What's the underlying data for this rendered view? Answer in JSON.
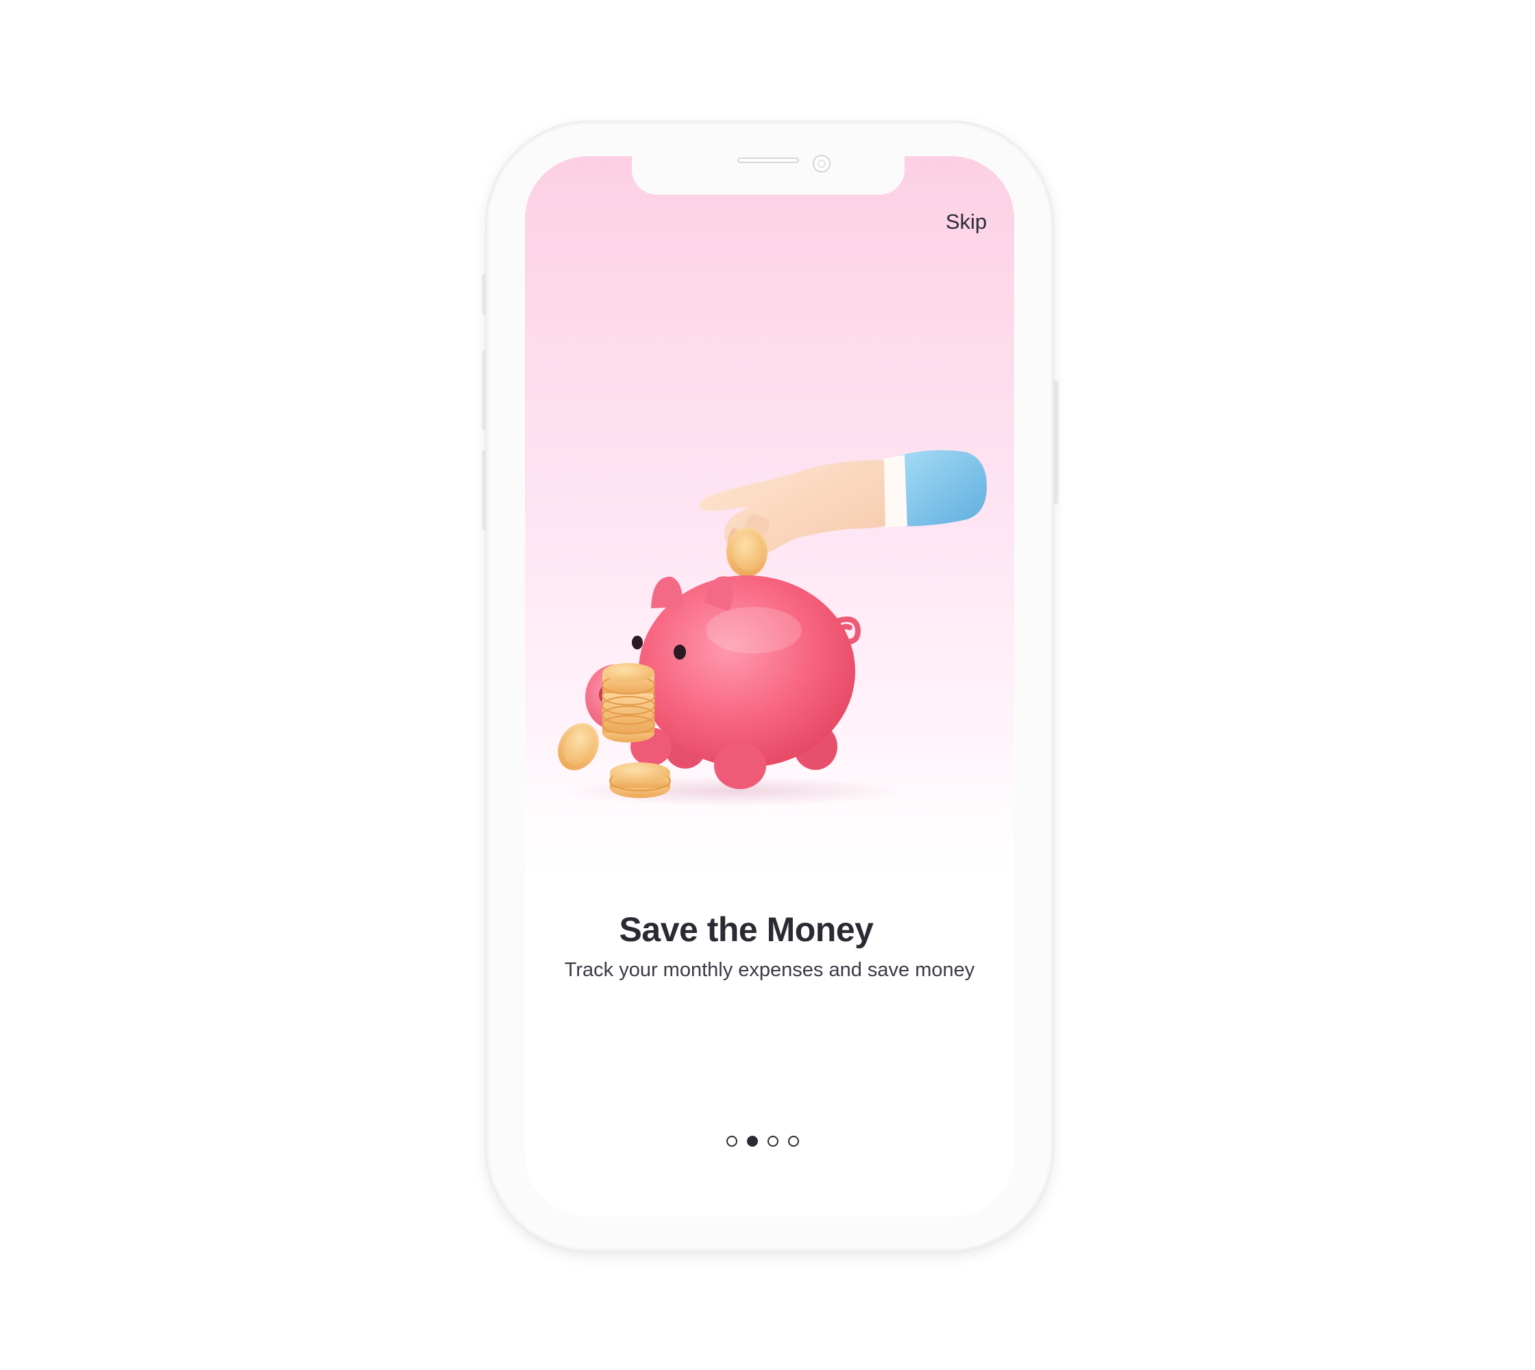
{
  "onboarding": {
    "skip_label": "Skip",
    "title": "Save the Money",
    "subtitle": "Track your monthly expenses and save money",
    "pagination": {
      "total": 4,
      "active_index": 1
    }
  },
  "colors": {
    "gradient_top": "#fcd0e4",
    "text_dark": "#2a2a33",
    "pig": "#f4607c",
    "coin": "#f6c57a",
    "sleeve": "#7cc3ea"
  },
  "icons": {
    "illustration": "piggy-bank-with-coin-illustration"
  }
}
